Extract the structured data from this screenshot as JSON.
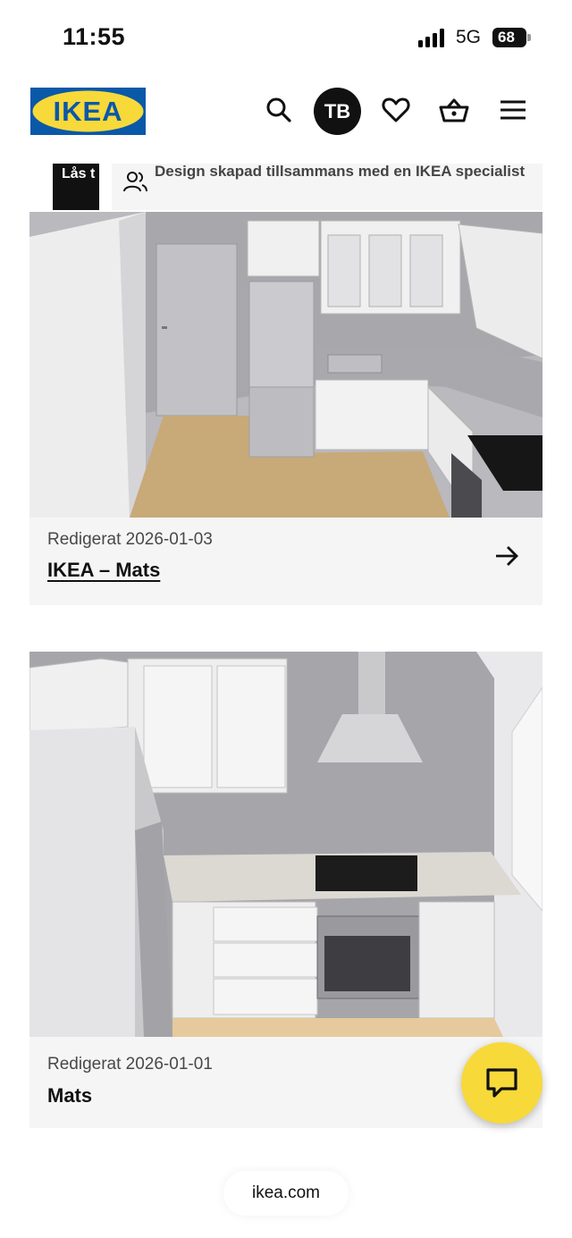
{
  "status_bar": {
    "time": "11:55",
    "network": "5G",
    "battery": "68"
  },
  "header": {
    "logo_text": "IKEA",
    "avatar_initials": "TB",
    "icons": [
      "search-icon",
      "heart-icon",
      "basket-icon",
      "menu-icon"
    ]
  },
  "designs": [
    {
      "locked_label": "Lås t",
      "tag_text": "Design skapad tillsammans med en IKEA specialist",
      "edited": "Redigerat 2026-01-03",
      "title": "IKEA – Mats"
    },
    {
      "edited": "Redigerat 2026-01-01",
      "title": "Mats"
    }
  ],
  "colors": {
    "ikea_blue": "#0a58a8",
    "ikea_yellow": "#f7d93a",
    "card_bg": "#f5f5f5"
  },
  "footer": {
    "url": "ikea.com"
  }
}
